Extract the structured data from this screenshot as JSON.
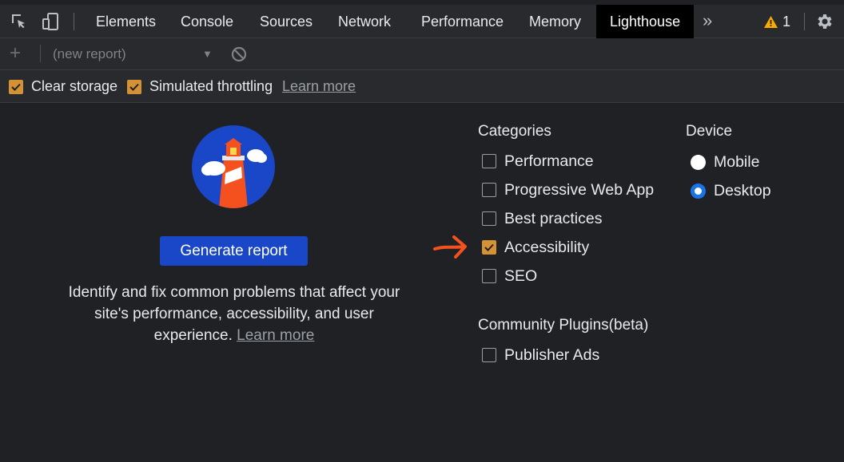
{
  "tabs": [
    {
      "label": "Elements"
    },
    {
      "label": "Console"
    },
    {
      "label": "Sources"
    },
    {
      "label": "Network"
    },
    {
      "label": "Performance"
    },
    {
      "label": "Memory"
    },
    {
      "label": "Lighthouse",
      "active": true
    }
  ],
  "tabbar": {
    "overflow": "»",
    "warning_count": "1",
    "icons": [
      "inspect-element-icon",
      "device-toolbar-icon",
      "warning-icon",
      "gear-icon"
    ]
  },
  "report_toolbar": {
    "add_label": "+",
    "report_select_value": "(new report)",
    "caret": "▼",
    "icons": [
      "plus-icon",
      "clear-block-icon"
    ]
  },
  "options": {
    "clear_storage": {
      "label": "Clear storage",
      "checked": true
    },
    "simulated_throttling": {
      "label": "Simulated throttling",
      "checked": true
    },
    "learn_more": "Learn more"
  },
  "main": {
    "generate_button": "Generate report",
    "description": "Identify and fix common problems that affect your site's performance, accessibility, and user experience.",
    "learn_more": "Learn more"
  },
  "categories": {
    "title": "Categories",
    "items": [
      {
        "label": "Performance",
        "checked": false
      },
      {
        "label": "Progressive Web App",
        "checked": false
      },
      {
        "label": "Best practices",
        "checked": false
      },
      {
        "label": "Accessibility",
        "checked": true
      },
      {
        "label": "SEO",
        "checked": false
      }
    ]
  },
  "device": {
    "title": "Device",
    "options": [
      {
        "label": "Mobile",
        "selected": false
      },
      {
        "label": "Desktop",
        "selected": true
      }
    ]
  },
  "plugins": {
    "title": "Community Plugins(beta)",
    "items": [
      {
        "label": "Publisher Ads",
        "checked": false
      }
    ]
  },
  "colors": {
    "accent_orange": "#d49234",
    "button_blue": "#1a46c8",
    "radio_blue": "#1a73e8",
    "annotation_arrow": "#f4511e"
  }
}
